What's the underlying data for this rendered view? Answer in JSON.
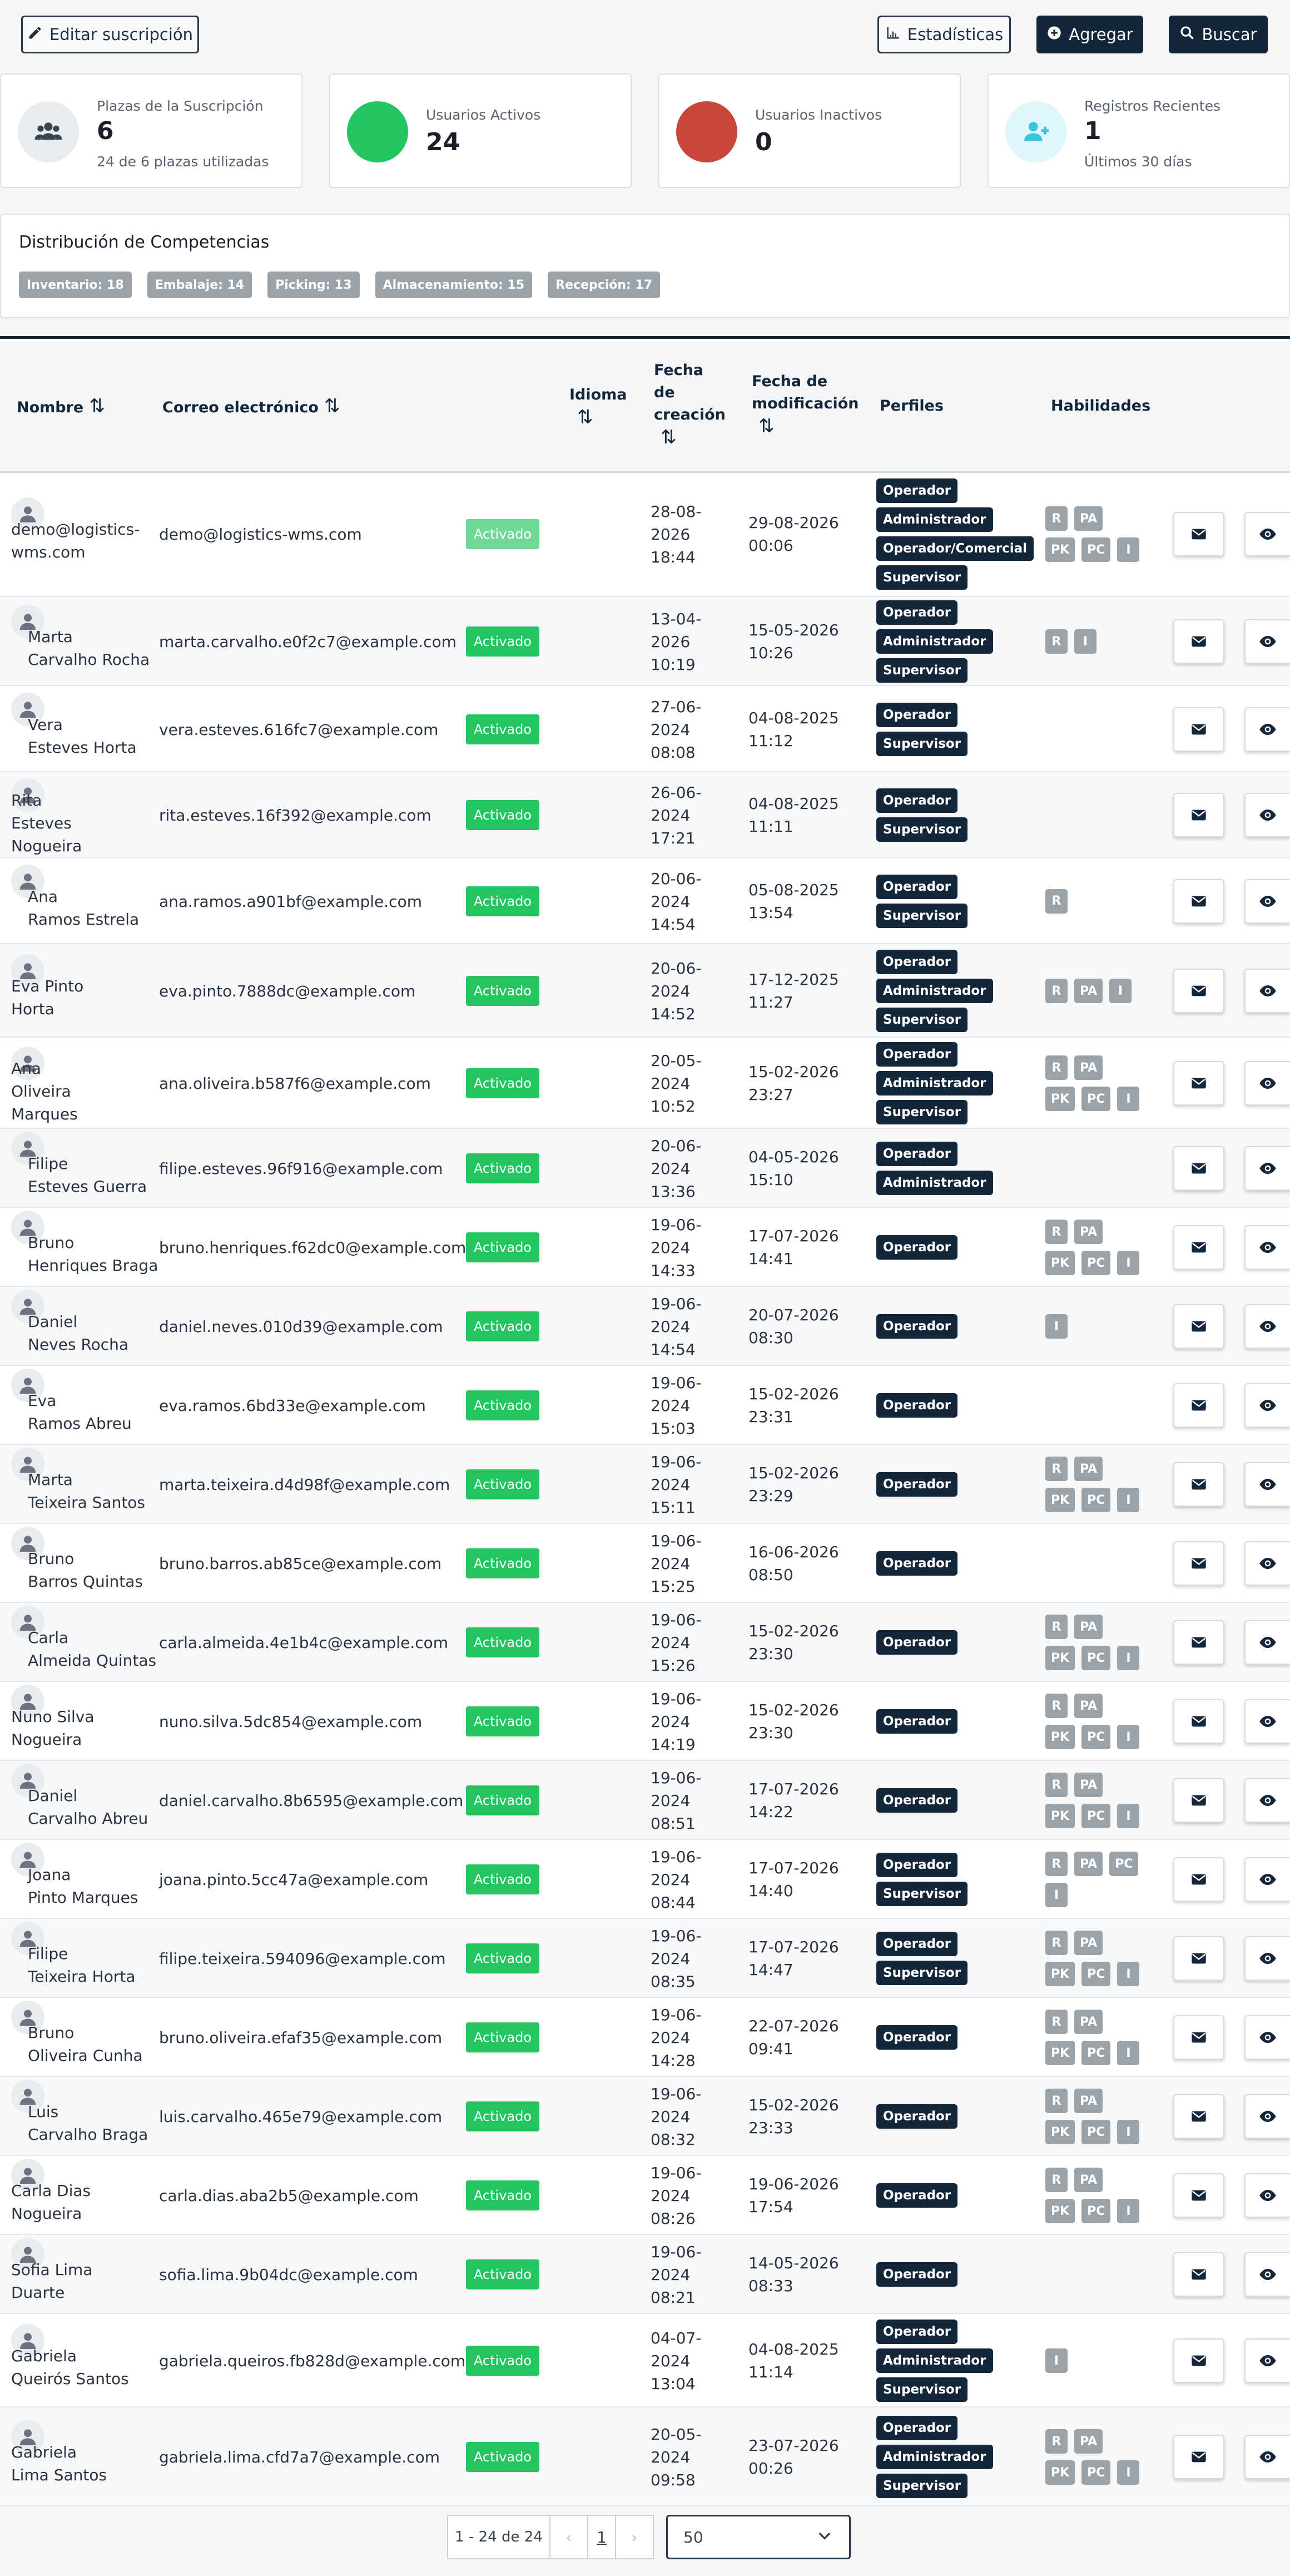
{
  "toolbar": {
    "edit_label": "Editar suscripción",
    "stats_label": "Estadísticas",
    "add_label": "Agregar",
    "search_label": "Buscar"
  },
  "cards": {
    "seats": {
      "label": "Plazas de la Suscripción",
      "value": "6",
      "sub": "24 de 6 plazas utilizadas",
      "icon": "users-icon"
    },
    "active": {
      "label": "Usuarios Activos",
      "value": "24",
      "color": "#22c55e"
    },
    "inactive": {
      "label": "Usuarios Inactivos",
      "value": "0",
      "color": "#c9463d"
    },
    "recent": {
      "label": "Registros Recientes",
      "value": "1",
      "sub": "Últimos 30 días",
      "icon": "user-plus-icon"
    }
  },
  "competencies": {
    "title": "Distribución de Competencias",
    "items": [
      "Inventario: 18",
      "Embalaje: 14",
      "Picking: 13",
      "Almacenamiento: 15",
      "Recepción: 17"
    ]
  },
  "table": {
    "headers": {
      "name": "Nombre",
      "email": "Correo electrónico",
      "lang": "Idioma",
      "created": [
        "Fecha",
        "de",
        "creación"
      ],
      "modified": [
        "Fecha de",
        "modificación"
      ],
      "profiles": "Perfiles",
      "skills": "Habilidades"
    },
    "rows": [
      {
        "name": [
          "demo@logistics-",
          "wms.com"
        ],
        "email": "demo@logistics-wms.com",
        "status": "Activado",
        "created": [
          "28-08-",
          "2026",
          "18:44"
        ],
        "modified": [
          "29-08-2026",
          "00:06"
        ],
        "profiles": [
          "Operador",
          "Administrador",
          "Operador/Comercial",
          "Supervisor"
        ],
        "skills": [
          [
            "R",
            "PA"
          ],
          [
            "PK",
            "PC",
            "I"
          ]
        ]
      },
      {
        "name": [
          "Marta",
          "Carvalho Rocha"
        ],
        "email": "marta.carvalho.e0f2c7@example.com",
        "status": "Activado",
        "created": [
          "13-04-",
          "2026",
          "10:19"
        ],
        "modified": [
          "15-05-2026",
          "10:26"
        ],
        "profiles": [
          "Operador",
          "Administrador",
          "Supervisor"
        ],
        "skills": [
          [
            "R",
            "I"
          ]
        ]
      },
      {
        "name": [
          "Vera",
          "Esteves Horta"
        ],
        "email": "vera.esteves.616fc7@example.com",
        "status": "Activado",
        "created": [
          "27-06-",
          "2024",
          "08:08"
        ],
        "modified": [
          "04-08-2025",
          "11:12"
        ],
        "profiles": [
          "Operador",
          "Supervisor"
        ],
        "skills": []
      },
      {
        "name": [
          "Rita",
          "Esteves",
          "Nogueira"
        ],
        "email": "rita.esteves.16f392@example.com",
        "status": "Activado",
        "created": [
          "26-06-",
          "2024",
          "17:21"
        ],
        "modified": [
          "04-08-2025",
          "11:11"
        ],
        "profiles": [
          "Operador",
          "Supervisor"
        ],
        "skills": []
      },
      {
        "name": [
          "Ana",
          "Ramos Estrela"
        ],
        "email": "ana.ramos.a901bf@example.com",
        "status": "Activado",
        "created": [
          "20-06-",
          "2024",
          "14:54"
        ],
        "modified": [
          "05-08-2025",
          "13:54"
        ],
        "profiles": [
          "Operador",
          "Supervisor"
        ],
        "skills": [
          [
            "R"
          ]
        ]
      },
      {
        "name": [
          "Eva Pinto",
          "Horta"
        ],
        "email": "eva.pinto.7888dc@example.com",
        "status": "Activado",
        "created": [
          "20-06-",
          "2024",
          "14:52"
        ],
        "modified": [
          "17-12-2025",
          "11:27"
        ],
        "profiles": [
          "Operador",
          "Administrador",
          "Supervisor"
        ],
        "skills": [
          [
            "R",
            "PA",
            "I"
          ]
        ]
      },
      {
        "name": [
          "Ana",
          "Oliveira",
          "Marques"
        ],
        "email": "ana.oliveira.b587f6@example.com",
        "status": "Activado",
        "created": [
          "20-05-",
          "2024",
          "10:52"
        ],
        "modified": [
          "15-02-2026",
          "23:27"
        ],
        "profiles": [
          "Operador",
          "Administrador",
          "Supervisor"
        ],
        "skills": [
          [
            "R",
            "PA"
          ],
          [
            "PK",
            "PC",
            "I"
          ]
        ]
      },
      {
        "name": [
          "Filipe",
          "Esteves Guerra"
        ],
        "email": "filipe.esteves.96f916@example.com",
        "status": "Activado",
        "created": [
          "20-06-",
          "2024",
          "13:36"
        ],
        "modified": [
          "04-05-2026",
          "15:10"
        ],
        "profiles": [
          "Operador",
          "Administrador"
        ],
        "skills": []
      },
      {
        "name": [
          "Bruno",
          "Henriques Braga"
        ],
        "email": "bruno.henriques.f62dc0@example.com",
        "status": "Activado",
        "created": [
          "19-06-",
          "2024",
          "14:33"
        ],
        "modified": [
          "17-07-2026",
          "14:41"
        ],
        "profiles": [
          "Operador"
        ],
        "skills": [
          [
            "R",
            "PA"
          ],
          [
            "PK",
            "PC",
            "I"
          ]
        ]
      },
      {
        "name": [
          "Daniel",
          "Neves Rocha"
        ],
        "email": "daniel.neves.010d39@example.com",
        "status": "Activado",
        "created": [
          "19-06-",
          "2024",
          "14:54"
        ],
        "modified": [
          "20-07-2026",
          "08:30"
        ],
        "profiles": [
          "Operador"
        ],
        "skills": [
          [
            "I"
          ]
        ]
      },
      {
        "name": [
          "Eva",
          "Ramos Abreu"
        ],
        "email": "eva.ramos.6bd33e@example.com",
        "status": "Activado",
        "created": [
          "19-06-",
          "2024",
          "15:03"
        ],
        "modified": [
          "15-02-2026",
          "23:31"
        ],
        "profiles": [
          "Operador"
        ],
        "skills": []
      },
      {
        "name": [
          "Marta",
          "Teixeira Santos"
        ],
        "email": "marta.teixeira.d4d98f@example.com",
        "status": "Activado",
        "created": [
          "19-06-",
          "2024",
          "15:11"
        ],
        "modified": [
          "15-02-2026",
          "23:29"
        ],
        "profiles": [
          "Operador"
        ],
        "skills": [
          [
            "R",
            "PA"
          ],
          [
            "PK",
            "PC",
            "I"
          ]
        ]
      },
      {
        "name": [
          "Bruno",
          "Barros Quintas"
        ],
        "email": "bruno.barros.ab85ce@example.com",
        "status": "Activado",
        "created": [
          "19-06-",
          "2024",
          "15:25"
        ],
        "modified": [
          "16-06-2026",
          "08:50"
        ],
        "profiles": [
          "Operador"
        ],
        "skills": []
      },
      {
        "name": [
          "Carla",
          "Almeida Quintas"
        ],
        "email": "carla.almeida.4e1b4c@example.com",
        "status": "Activado",
        "created": [
          "19-06-",
          "2024",
          "15:26"
        ],
        "modified": [
          "15-02-2026",
          "23:30"
        ],
        "profiles": [
          "Operador"
        ],
        "skills": [
          [
            "R",
            "PA"
          ],
          [
            "PK",
            "PC",
            "I"
          ]
        ]
      },
      {
        "name": [
          "Nuno Silva",
          "Nogueira"
        ],
        "email": "nuno.silva.5dc854@example.com",
        "status": "Activado",
        "created": [
          "19-06-",
          "2024",
          "14:19"
        ],
        "modified": [
          "15-02-2026",
          "23:30"
        ],
        "profiles": [
          "Operador"
        ],
        "skills": [
          [
            "R",
            "PA"
          ],
          [
            "PK",
            "PC",
            "I"
          ]
        ]
      },
      {
        "name": [
          "Daniel",
          "Carvalho Abreu"
        ],
        "email": "daniel.carvalho.8b6595@example.com",
        "status": "Activado",
        "created": [
          "19-06-",
          "2024",
          "08:51"
        ],
        "modified": [
          "17-07-2026",
          "14:22"
        ],
        "profiles": [
          "Operador"
        ],
        "skills": [
          [
            "R",
            "PA"
          ],
          [
            "PK",
            "PC",
            "I"
          ]
        ]
      },
      {
        "name": [
          "Joana",
          "Pinto Marques"
        ],
        "email": "joana.pinto.5cc47a@example.com",
        "status": "Activado",
        "created": [
          "19-06-",
          "2024",
          "08:44"
        ],
        "modified": [
          "17-07-2026",
          "14:40"
        ],
        "profiles": [
          "Operador",
          "Supervisor"
        ],
        "skills": [
          [
            "R",
            "PA",
            "PC"
          ],
          [
            "I"
          ]
        ]
      },
      {
        "name": [
          "Filipe",
          "Teixeira Horta"
        ],
        "email": "filipe.teixeira.594096@example.com",
        "status": "Activado",
        "created": [
          "19-06-",
          "2024",
          "08:35"
        ],
        "modified": [
          "17-07-2026",
          "14:47"
        ],
        "profiles": [
          "Operador",
          "Supervisor"
        ],
        "skills": [
          [
            "R",
            "PA"
          ],
          [
            "PK",
            "PC",
            "I"
          ]
        ]
      },
      {
        "name": [
          "Bruno",
          "Oliveira Cunha"
        ],
        "email": "bruno.oliveira.efaf35@example.com",
        "status": "Activado",
        "created": [
          "19-06-",
          "2024",
          "14:28"
        ],
        "modified": [
          "22-07-2026",
          "09:41"
        ],
        "profiles": [
          "Operador"
        ],
        "skills": [
          [
            "R",
            "PA"
          ],
          [
            "PK",
            "PC",
            "I"
          ]
        ]
      },
      {
        "name": [
          "Luis",
          "Carvalho Braga"
        ],
        "email": "luis.carvalho.465e79@example.com",
        "status": "Activado",
        "created": [
          "19-06-",
          "2024",
          "08:32"
        ],
        "modified": [
          "15-02-2026",
          "23:33"
        ],
        "profiles": [
          "Operador"
        ],
        "skills": [
          [
            "R",
            "PA"
          ],
          [
            "PK",
            "PC",
            "I"
          ]
        ]
      },
      {
        "name": [
          "Carla Dias",
          "Nogueira"
        ],
        "email": "carla.dias.aba2b5@example.com",
        "status": "Activado",
        "created": [
          "19-06-",
          "2024",
          "08:26"
        ],
        "modified": [
          "19-06-2026",
          "17:54"
        ],
        "profiles": [
          "Operador"
        ],
        "skills": [
          [
            "R",
            "PA"
          ],
          [
            "PK",
            "PC",
            "I"
          ]
        ]
      },
      {
        "name": [
          "Sofia Lima",
          "Duarte"
        ],
        "email": "sofia.lima.9b04dc@example.com",
        "status": "Activado",
        "created": [
          "19-06-",
          "2024",
          "08:21"
        ],
        "modified": [
          "14-05-2026",
          "08:33"
        ],
        "profiles": [
          "Operador"
        ],
        "skills": []
      },
      {
        "name": [
          "Gabriela",
          "Queirós Santos"
        ],
        "email": "gabriela.queiros.fb828d@example.com",
        "status": "Activado",
        "created": [
          "04-07-",
          "2024",
          "13:04"
        ],
        "modified": [
          "04-08-2025",
          "11:14"
        ],
        "profiles": [
          "Operador",
          "Administrador",
          "Supervisor"
        ],
        "skills": [
          [
            "I"
          ]
        ]
      },
      {
        "name": [
          "Gabriela",
          "Lima Santos"
        ],
        "email": "gabriela.lima.cfd7a7@example.com",
        "status": "Activado",
        "created": [
          "20-05-",
          "2024",
          "09:58"
        ],
        "modified": [
          "23-07-2026",
          "00:26"
        ],
        "profiles": [
          "Operador",
          "Administrador",
          "Supervisor"
        ],
        "skills": [
          [
            "R",
            "PA"
          ],
          [
            "PK",
            "PC",
            "I"
          ]
        ]
      }
    ]
  },
  "pagination": {
    "range": "1 - 24 de 24",
    "page": "1",
    "page_size": "50",
    "prev": "‹",
    "next": "›"
  }
}
